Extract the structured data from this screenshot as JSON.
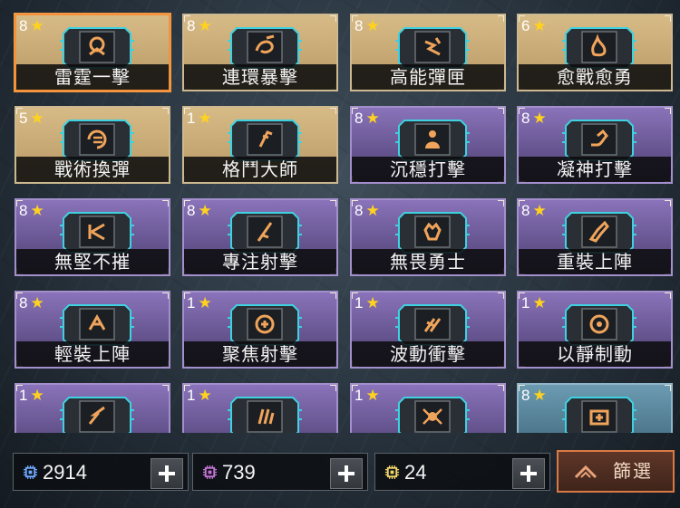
{
  "cards": [
    {
      "stars": "8",
      "name": "雷霆一擊",
      "rarity": "gold",
      "selected": true,
      "icon": "thunder-strike-icon"
    },
    {
      "stars": "8",
      "name": "連環暴擊",
      "rarity": "gold",
      "icon": "chain-crit-icon"
    },
    {
      "stars": "8",
      "name": "高能彈匣",
      "rarity": "gold",
      "icon": "energy-magazine-icon"
    },
    {
      "stars": "6",
      "name": "愈戰愈勇",
      "rarity": "gold",
      "icon": "fire-icon"
    },
    {
      "stars": "5",
      "name": "戰術換彈",
      "rarity": "gold",
      "icon": "reload-icon"
    },
    {
      "stars": "1",
      "name": "格鬥大師",
      "rarity": "gold",
      "icon": "melee-icon"
    },
    {
      "stars": "8",
      "name": "沉穩打擊",
      "rarity": "purple",
      "icon": "steady-strike-icon"
    },
    {
      "stars": "8",
      "name": "凝神打擊",
      "rarity": "purple",
      "icon": "arm-icon"
    },
    {
      "stars": "8",
      "name": "無堅不摧",
      "rarity": "purple",
      "icon": "break-icon"
    },
    {
      "stars": "8",
      "name": "專注射擊",
      "rarity": "purple",
      "icon": "focus-shot-icon"
    },
    {
      "stars": "8",
      "name": "無畏勇士",
      "rarity": "purple",
      "icon": "fist-icon"
    },
    {
      "stars": "8",
      "name": "重裝上陣",
      "rarity": "purple",
      "icon": "heavy-gun-icon"
    },
    {
      "stars": "8",
      "name": "輕裝上陣",
      "rarity": "purple",
      "icon": "light-armor-icon"
    },
    {
      "stars": "1",
      "name": "聚焦射擊",
      "rarity": "purple",
      "icon": "crosshair-icon"
    },
    {
      "stars": "1",
      "name": "波動衝擊",
      "rarity": "purple",
      "icon": "wave-impact-icon"
    },
    {
      "stars": "1",
      "name": "以靜制動",
      "rarity": "purple",
      "icon": "target-icon"
    },
    {
      "stars": "1",
      "name": "",
      "rarity": "purple",
      "icon": "bolt-icon"
    },
    {
      "stars": "1",
      "name": "",
      "rarity": "purple",
      "icon": "bullets-icon"
    },
    {
      "stars": "1",
      "name": "",
      "rarity": "purple",
      "icon": "spider-icon"
    },
    {
      "stars": "8",
      "name": "",
      "rarity": "teal",
      "icon": "medkit-icon"
    }
  ],
  "resources": [
    {
      "value": "2914",
      "icon": "blue-chip-icon",
      "color": "#6fa8ff"
    },
    {
      "value": "739",
      "icon": "purple-chip-icon",
      "color": "#c373d6"
    },
    {
      "value": "24",
      "icon": "gold-chip-icon",
      "color": "#f0d66a"
    }
  ],
  "filter": {
    "label": "篩選",
    "icon": "filter-chevron-icon"
  },
  "colors": {
    "gold_card": "#c9a877",
    "purple_card": "#6b5a96",
    "teal_card": "#5a8aa2",
    "selected_border": "#f5913a",
    "filter_border": "#d97a46"
  }
}
